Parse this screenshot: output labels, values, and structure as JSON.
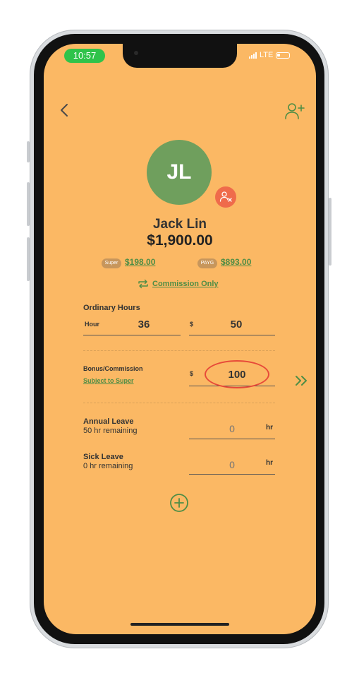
{
  "status_bar": {
    "time": "10:57",
    "network": "LTE"
  },
  "employee": {
    "initials": "JL",
    "name": "Jack Lin",
    "total": "$1,900.00",
    "super_badge": "Super",
    "super_amount": "$198.00",
    "payg_badge": "PAYG",
    "payg_amount": "$893.00",
    "pay_type": "Commission Only"
  },
  "ordinary_hours": {
    "title": "Ordinary Hours",
    "hour_label": "Hour",
    "hours": "36",
    "currency_symbol": "$",
    "rate": "50"
  },
  "bonus": {
    "title": "Bonus/Commission",
    "subject_link": "Subject to Super",
    "currency_symbol": "$",
    "amount": "100"
  },
  "annual_leave": {
    "title": "Annual Leave",
    "remaining": "50 hr remaining",
    "placeholder": "0",
    "unit": "hr"
  },
  "sick_leave": {
    "title": "Sick Leave",
    "remaining": "0 hr remaining",
    "placeholder": "0",
    "unit": "hr"
  },
  "icons": {
    "back": "chevron-left-icon",
    "add_user": "add-user-icon",
    "remove_user": "remove-user-icon",
    "swap": "swap-arrows-icon",
    "next": "double-chevron-right-icon",
    "add": "plus-circle-icon"
  },
  "colors": {
    "background": "#fbb864",
    "accent_green": "#4e8d45",
    "avatar_green": "#6f9f5d",
    "remove_red": "#ef6b4b",
    "highlight_red": "#e74a39",
    "status_green": "#2fc34a"
  }
}
